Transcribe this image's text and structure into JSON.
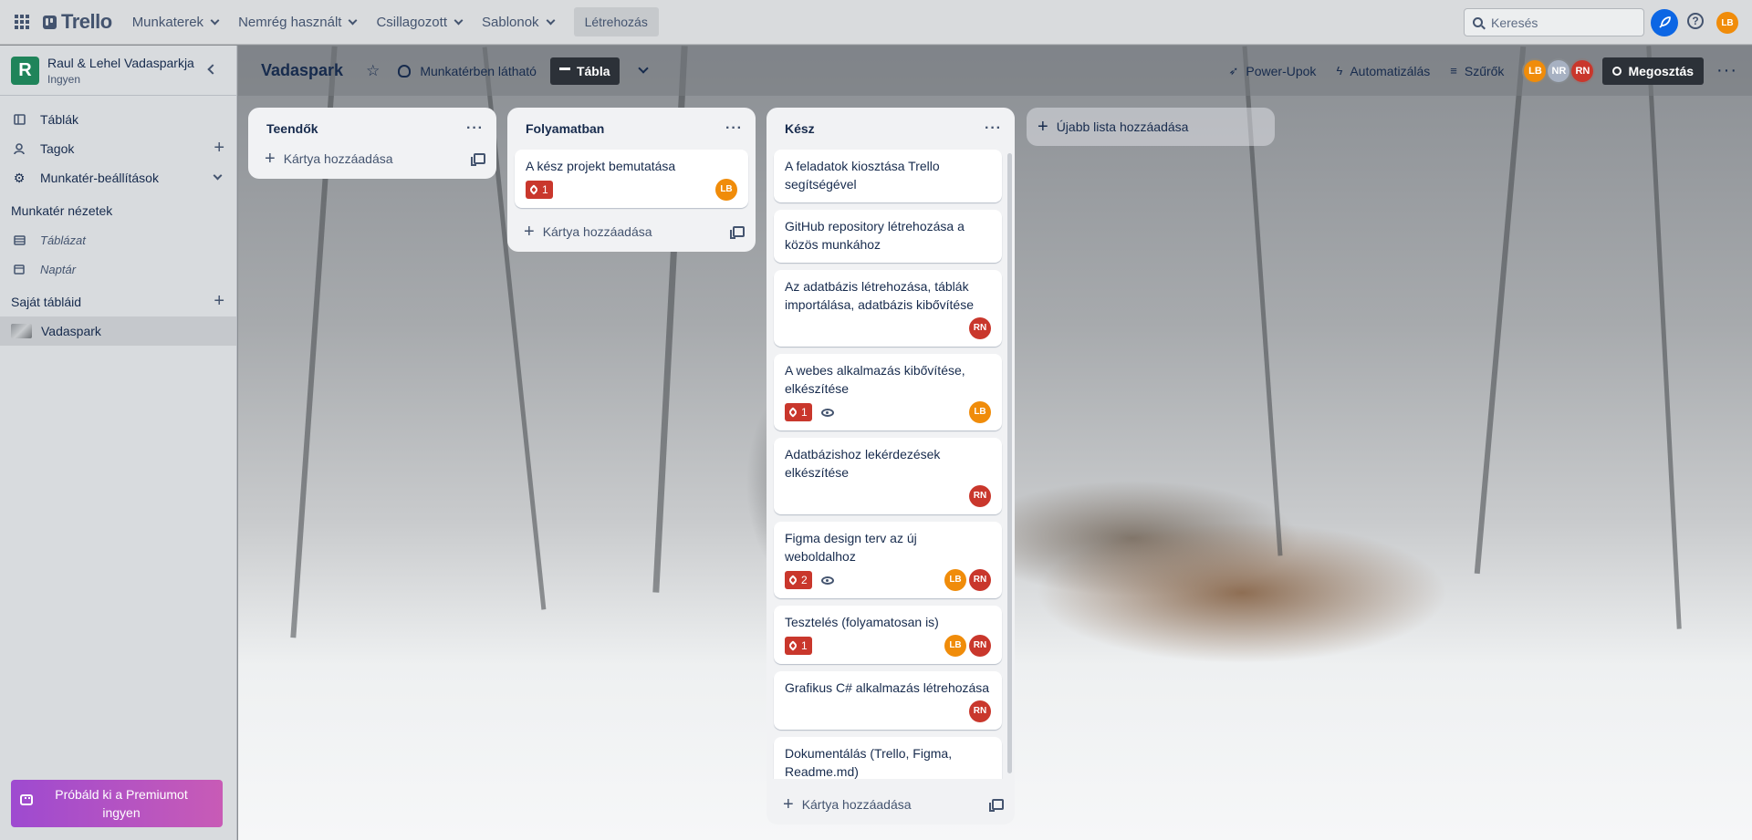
{
  "topbar": {
    "logo": "Trello",
    "nav": [
      "Munkaterek",
      "Nemrég használt",
      "Csillagozott",
      "Sablonok"
    ],
    "create": "Létrehozás",
    "search_placeholder": "Keresés",
    "help": "?",
    "user_initials": "LB"
  },
  "sidebar": {
    "workspace_initial": "R",
    "workspace_name": "Raul & Lehel Vadasparkja",
    "workspace_plan": "Ingyen",
    "items": [
      {
        "label": "Táblák",
        "icon": "board-icon"
      },
      {
        "label": "Tagok",
        "icon": "person-icon"
      },
      {
        "label": "Munkatér-beállítások",
        "icon": "gear-icon"
      }
    ],
    "views_title": "Munkatér nézetek",
    "views": [
      "Táblázat",
      "Naptár"
    ],
    "boards_title": "Saját tábláid",
    "boards": [
      "Vadaspark"
    ],
    "premium": "Próbáld ki a Premiumot ingyen"
  },
  "board": {
    "title": "Vadaspark",
    "visibility": "Munkatérben látható",
    "view": "Tábla",
    "powerups": "Power-Upok",
    "automation": "Automatizálás",
    "filters": "Szűrők",
    "members": [
      "LB",
      "NR",
      "RN"
    ],
    "share": "Megosztás",
    "add_list": "Újabb lista hozzáadása"
  },
  "lists": [
    {
      "title": "Teendők",
      "add_card": "Kártya hozzáadása",
      "cards": []
    },
    {
      "title": "Folyamatban",
      "add_card": "Kártya hozzáadása",
      "cards": [
        {
          "title": "A kész projekt bemutatása",
          "badge": "1",
          "watch": false,
          "members": [
            "LB"
          ]
        }
      ]
    },
    {
      "title": "Kész",
      "add_card": "Kártya hozzáadása",
      "cards": [
        {
          "title": "A feladatok kiosztása Trello segítségével",
          "badge": "",
          "watch": false,
          "members": []
        },
        {
          "title": "GitHub repository létrehozása a közös munkához",
          "badge": "",
          "watch": false,
          "members": []
        },
        {
          "title": "Az adatbázis létrehozása, táblák importálása, adatbázis kibővítése",
          "badge": "",
          "watch": false,
          "members": [
            "RN"
          ]
        },
        {
          "title": "A webes alkalmazás kibővítése, elkészítése",
          "badge": "1",
          "watch": true,
          "members": [
            "LB"
          ]
        },
        {
          "title": "Adatbázishoz lekérdezések elkészítése",
          "badge": "",
          "watch": false,
          "members": [
            "RN"
          ]
        },
        {
          "title": "Figma design terv az új weboldalhoz",
          "badge": "2",
          "watch": true,
          "members": [
            "LB",
            "RN"
          ]
        },
        {
          "title": "Tesztelés (folyamatosan is)",
          "badge": "1",
          "watch": false,
          "members": [
            "LB",
            "RN"
          ]
        },
        {
          "title": "Grafikus C# alkalmazás létrehozása",
          "badge": "",
          "watch": false,
          "members": [
            "RN"
          ]
        },
        {
          "title": "Dokumentálás (Trello, Figma, Readme.md)",
          "badge": "",
          "watch": false,
          "members": []
        }
      ]
    }
  ],
  "colors": {
    "lb": "#f08c0a",
    "rn": "#c9372c",
    "nr": "#a7b1c2",
    "workspace": "#1f845a",
    "label_red": "#c9372c"
  }
}
